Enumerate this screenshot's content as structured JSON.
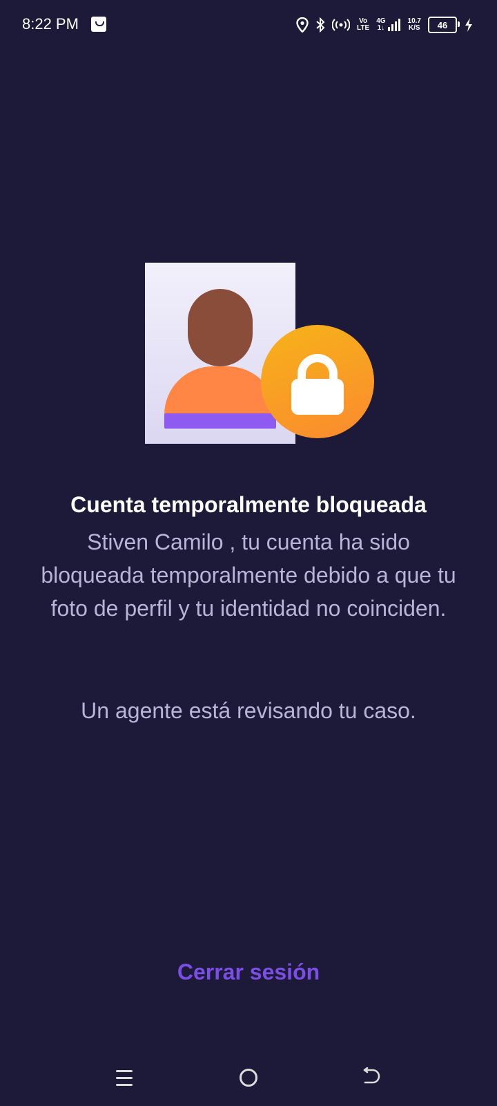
{
  "status_bar": {
    "time": "8:22 PM",
    "net_top": "Vo",
    "net_bottom": "LTE",
    "sig_top": "4G",
    "sig_bottom": "1↓",
    "speed_top": "10.7",
    "speed_bottom": "K/S",
    "battery": "46",
    "icons": [
      "shopping-bag-icon",
      "location-icon",
      "bluetooth-icon",
      "hotspot-icon",
      "signal-icon",
      "battery-icon",
      "charging-icon"
    ]
  },
  "colors": {
    "background": "#1c1a38",
    "accent": "#7b4ee6",
    "text_secondary": "#b9b4d8"
  },
  "content": {
    "title": "Cuenta temporalmente bloqueada",
    "message": "Stiven Camilo , tu cuenta ha sido bloqueada temporalmente debido a que tu foto de perfil y tu identidad no coinciden.",
    "note": "Un agente está revisando tu caso."
  },
  "actions": {
    "logout_label": "Cerrar sesión"
  },
  "nav": {
    "icons": [
      "menu-icon",
      "home-icon",
      "back-icon"
    ]
  }
}
